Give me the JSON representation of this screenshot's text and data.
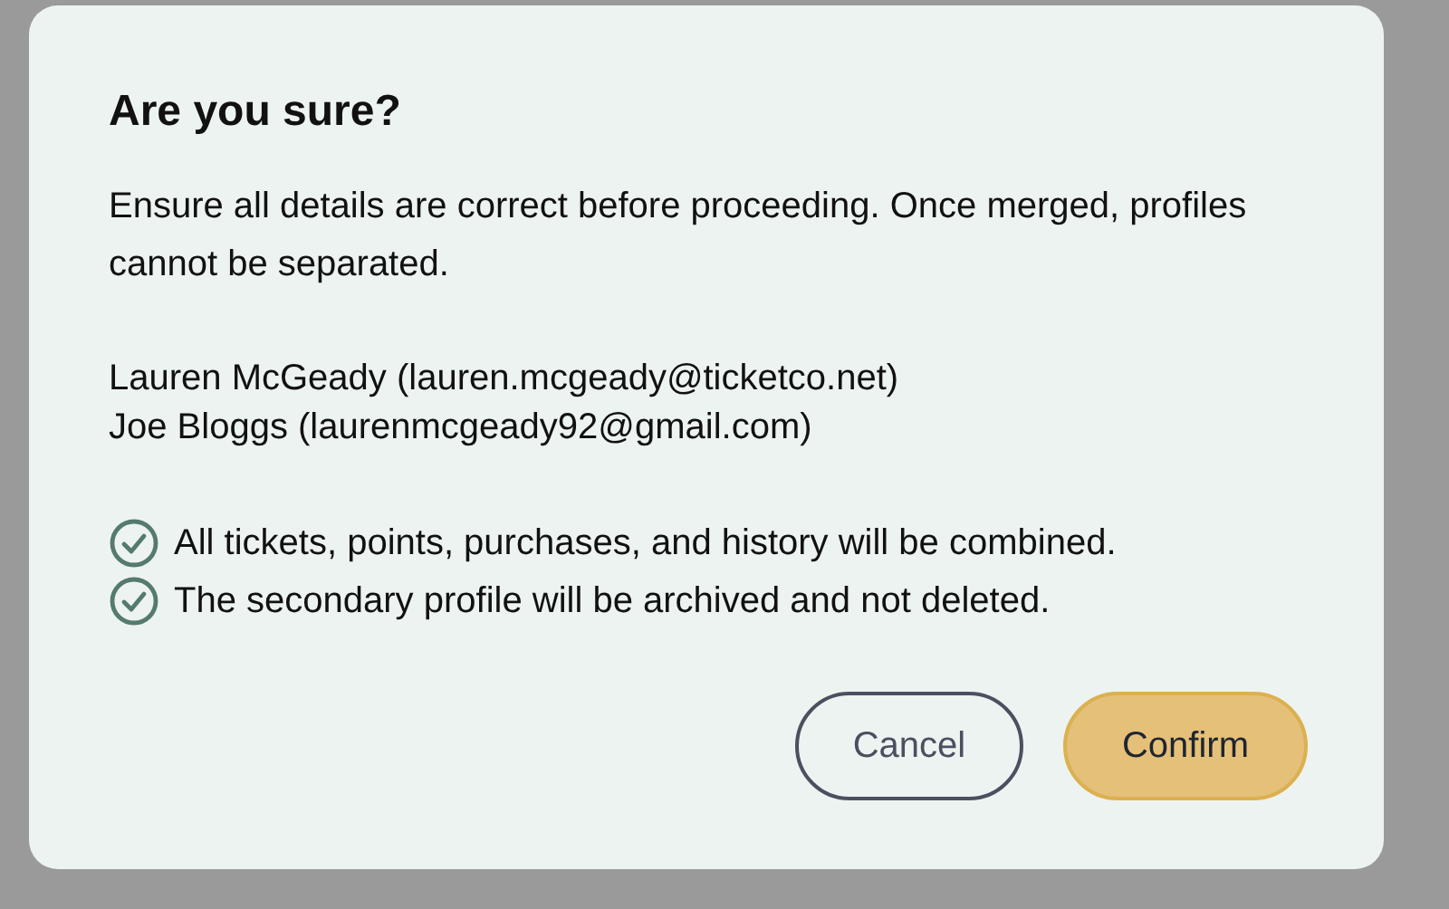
{
  "dialog": {
    "title": "Are you sure?",
    "message": "Ensure all details are correct before proceeding. Once merged, profiles cannot be separated.",
    "profiles": [
      "Lauren McGeady (lauren.mcgeady@ticketco.net)",
      "Joe Bloggs (laurenmcgeady92@gmail.com)"
    ],
    "checks": [
      {
        "text": "All tickets, points, purchases, and history will be combined.",
        "checked": true
      },
      {
        "text": "The secondary profile will be archived and not deleted.",
        "checked": true
      }
    ],
    "buttons": [
      {
        "label": "Cancel",
        "kind": "secondary"
      },
      {
        "label": "Confirm",
        "kind": "primary"
      }
    ]
  }
}
